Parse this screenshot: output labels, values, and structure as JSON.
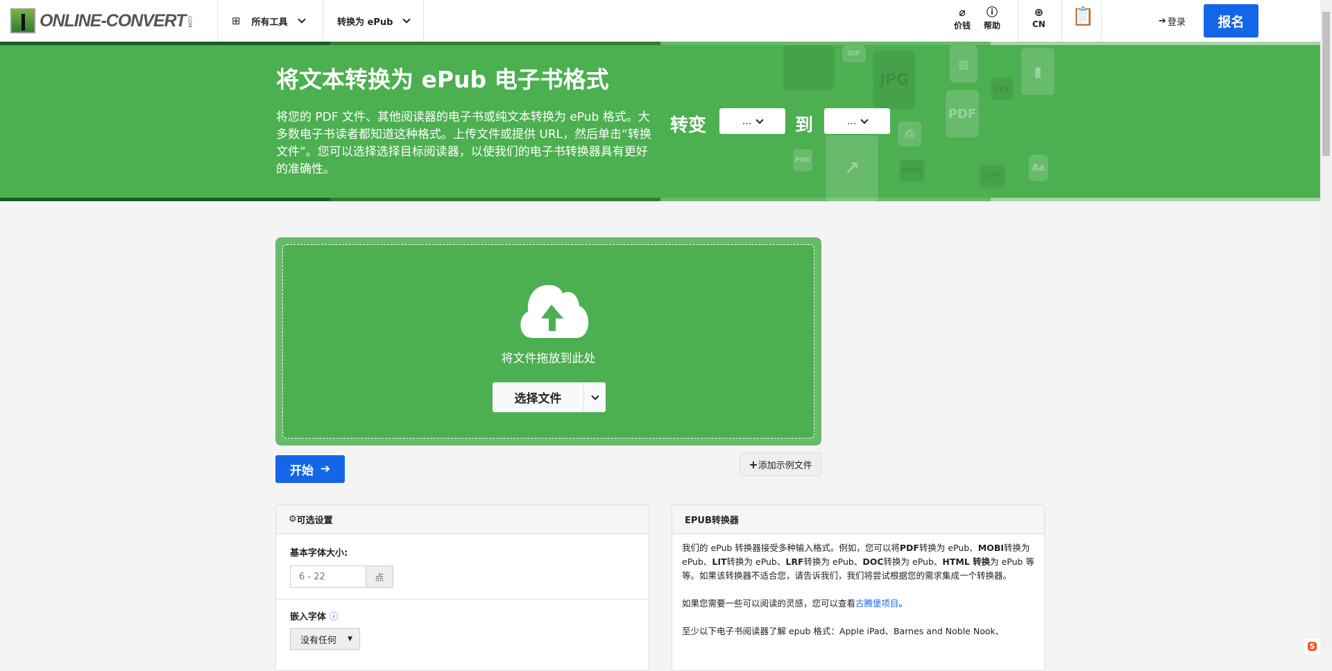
{
  "header": {
    "logo_text": "ONLINE-CONVERT",
    "logo_suffix": ".COM",
    "all_tools": "所有工具",
    "convert_to": "转换为 ePub",
    "pricing": "价钱",
    "help": "帮助",
    "language": "CN",
    "login": "登录",
    "signup": "报名"
  },
  "banner": {
    "title": "将文本转换为 ePub 电子书格式",
    "description": "将您的 PDF 文件、其他阅读器的电子书或纯文本转换为 ePub 格式。大多数电子书读者都知道这种格式。上传文件或提供 URL，然后单击“转换文件”。您可以选择选择目标阅读器，以使我们的电子书转换器具有更好的准确性。",
    "convert_label": "转变",
    "to_label": "到",
    "from_value": "...",
    "to_value": "...",
    "deco_labels": [
      "GIF",
      "JPG",
      "XLS",
      "PDF",
      "PNG",
      "DOCX",
      "TIFF",
      "Aa"
    ],
    "colors": {
      "green": "#4caf50"
    }
  },
  "upload": {
    "drop_text": "将文件拖放到此处",
    "choose_file": "选择文件",
    "start": "开始",
    "add_sample": "添加示例文件",
    "faint_id": "1754959671"
  },
  "options": {
    "title": "可选设置",
    "base_font_label": "基本字体大小:",
    "base_font_placeholder": "6 - 22",
    "base_font_unit": "点",
    "embed_font_label": "嵌入字体",
    "embed_font_value": "没有任何"
  },
  "info": {
    "title": "EPUB转换器",
    "p1_parts": [
      "我们的 ePub 转换器接受多种输入格式。例如，您可以将",
      "PDF",
      "转换为 ePub、",
      "MOBI",
      "转换为 ePub、",
      "LIT",
      "转换为 ePub、",
      "LRF",
      "转换为 ePub、",
      "DOC",
      "转换为 ePub、",
      "HTML 转换",
      "为 ePub 等等。如果该转换器不适合您，请告诉我们，我们将尝试根据您的需求集成一个转换器。"
    ],
    "p2_prefix": "如果您需要一些可以阅读的灵感，您可以查看",
    "p2_link": "古腾堡项目",
    "p2_suffix": "。",
    "p3": "至少以下电子书阅读器了解 epub 格式：Apple iPad、Barnes and Noble Nook、"
  }
}
